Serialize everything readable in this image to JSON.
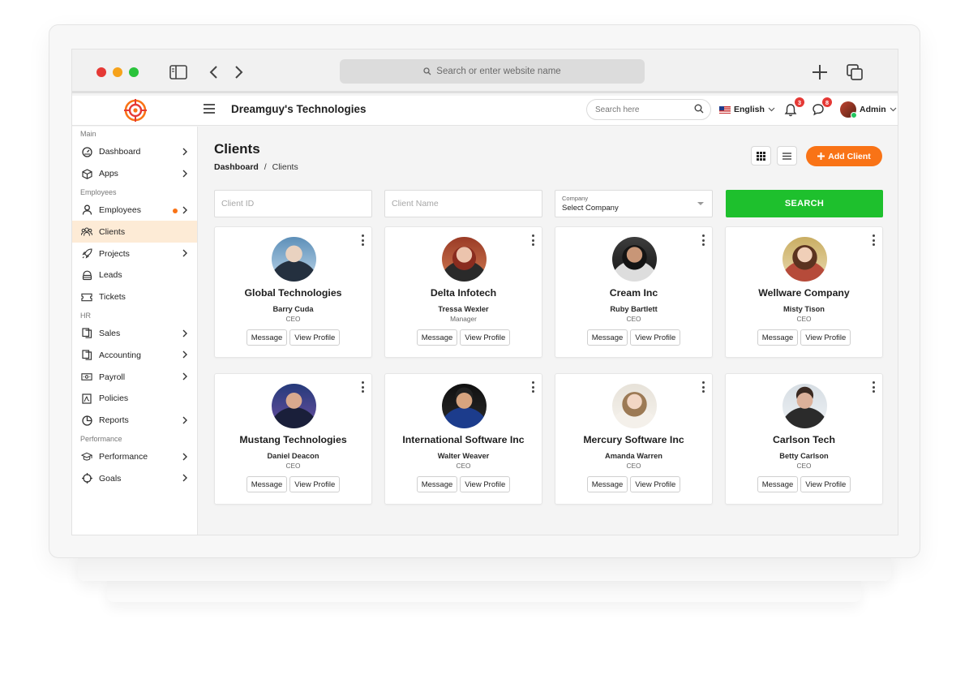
{
  "browser": {
    "url_placeholder": "Search or enter website name",
    "controls": [
      "sidebar-toggle-icon",
      "back-icon",
      "forward-icon",
      "new-tab-icon",
      "tabs-icon"
    ]
  },
  "header": {
    "company": "Dreamguy's Technologies",
    "search_placeholder": "Search here",
    "language": "English",
    "notifications_count": "3",
    "messages_count": "8",
    "user": "Admin"
  },
  "sidebar": {
    "sections": [
      {
        "title": "Main",
        "items": [
          {
            "label": "Dashboard",
            "icon": "dashboard-icon",
            "chevron": true
          },
          {
            "label": "Apps",
            "icon": "cube-icon",
            "chevron": true
          }
        ]
      },
      {
        "title": "Employees",
        "items": [
          {
            "label": "Employees",
            "icon": "user-icon",
            "chevron": true,
            "dot": true
          },
          {
            "label": "Clients",
            "icon": "users-icon",
            "chevron": false,
            "active": true
          },
          {
            "label": "Projects",
            "icon": "rocket-icon",
            "chevron": true
          },
          {
            "label": "Leads",
            "icon": "headset-icon",
            "chevron": false
          },
          {
            "label": "Tickets",
            "icon": "ticket-icon",
            "chevron": false
          }
        ]
      },
      {
        "title": "HR",
        "items": [
          {
            "label": "Sales",
            "icon": "files-icon",
            "chevron": true
          },
          {
            "label": "Accounting",
            "icon": "files-icon",
            "chevron": true
          },
          {
            "label": "Payroll",
            "icon": "cash-icon",
            "chevron": true
          },
          {
            "label": "Policies",
            "icon": "document-icon",
            "chevron": false
          },
          {
            "label": "Reports",
            "icon": "pie-chart-icon",
            "chevron": true
          }
        ]
      },
      {
        "title": "Performance",
        "items": [
          {
            "label": "Performance",
            "icon": "graduation-cap-icon",
            "chevron": true
          },
          {
            "label": "Goals",
            "icon": "crosshair-icon",
            "chevron": true
          }
        ]
      }
    ]
  },
  "page": {
    "title": "Clients",
    "breadcrumb_home": "Dashboard",
    "breadcrumb_sep": "/",
    "breadcrumb_current": "Clients",
    "add_button": "Add Client"
  },
  "filters": {
    "client_id_placeholder": "Client ID",
    "client_name_placeholder": "Client Name",
    "company_label": "Company",
    "company_value": "Select Company",
    "search_button": "SEARCH"
  },
  "clients": [
    {
      "company": "Global Technologies",
      "name": "Barry Cuda",
      "role": "CEO"
    },
    {
      "company": "Delta Infotech",
      "name": "Tressa Wexler",
      "role": "Manager"
    },
    {
      "company": "Cream Inc",
      "name": "Ruby Bartlett",
      "role": "CEO"
    },
    {
      "company": "Wellware Company",
      "name": "Misty Tison",
      "role": "CEO"
    },
    {
      "company": "Mustang Technologies",
      "name": "Daniel Deacon",
      "role": "CEO"
    },
    {
      "company": "International Software Inc",
      "name": "Walter Weaver",
      "role": "CEO"
    },
    {
      "company": "Mercury Software Inc",
      "name": "Amanda Warren",
      "role": "CEO"
    },
    {
      "company": "Carlson Tech",
      "name": "Betty Carlson",
      "role": "CEO"
    }
  ],
  "card_buttons": {
    "message": "Message",
    "view_profile": "View Profile"
  },
  "colors": {
    "accent": "#f97316",
    "search_green": "#1ec02d",
    "active_nav": "#fdebd6",
    "badge_red": "#e53935"
  }
}
